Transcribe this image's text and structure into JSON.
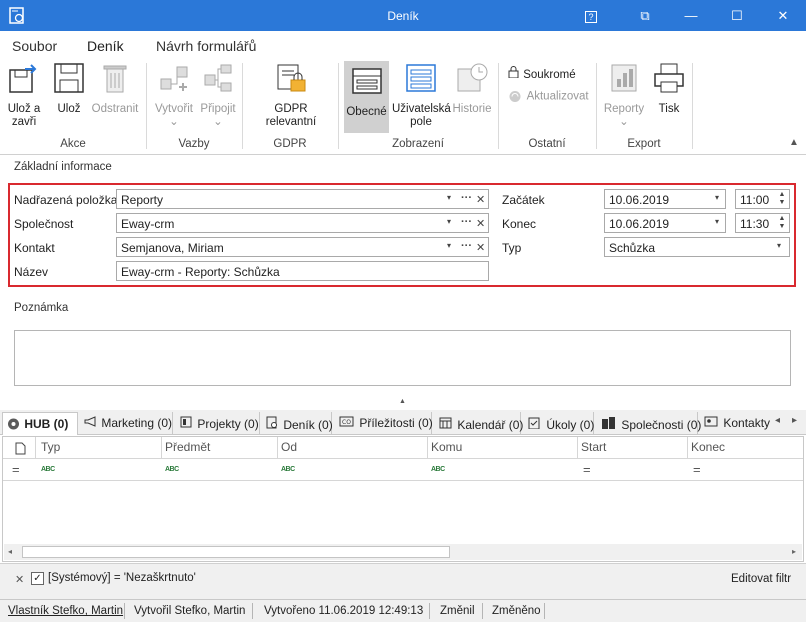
{
  "window": {
    "title": "Deník",
    "help_glyph": "?",
    "restore_glyph": "⧉",
    "min_glyph": "—",
    "max_glyph": "☐",
    "close_glyph": "✕"
  },
  "menu": {
    "tabs": [
      "Soubor",
      "Deník",
      "Návrh formulářů"
    ],
    "active": 1
  },
  "ribbon": {
    "save_close": "Ulož a zavři",
    "save": "Ulož",
    "delete": "Odstranit",
    "create": "Vytvořit",
    "attach": "Připojit",
    "gdpr_relevant": "GDPR relevantní",
    "general": "Obecné",
    "user_fields": "Uživatelská pole",
    "history": "Historie",
    "private": "Soukromé",
    "refresh": "Aktualizovat",
    "reports": "Reporty",
    "print": "Tisk",
    "groups": {
      "actions": "Akce",
      "links": "Vazby",
      "gdpr": "GDPR",
      "view": "Zobrazení",
      "other": "Ostatní",
      "export": "Export"
    },
    "dropdown_glyph": "⌄"
  },
  "form": {
    "section_title": "Základní informace",
    "parent_label": "Nadřazená položka",
    "parent_value": "Reporty",
    "company_label": "Společnost",
    "company_value": "Eway-crm",
    "contact_label": "Kontakt",
    "contact_value": "Semjanova, Miriam",
    "name_label": "Název",
    "name_value": "Eway-crm -  Reporty: Schůzka",
    "start_label": "Začátek",
    "start_date": "10.06.2019",
    "start_time": "11:00",
    "end_label": "Konec",
    "end_date": "10.06.2019",
    "end_time": "11:30",
    "type_label": "Typ",
    "type_value": "Schůzka",
    "dropdown_glyph": "▾",
    "more_glyph": "···",
    "clear_glyph": "✕",
    "spin_up": "▲",
    "spin_down": "▼"
  },
  "note": {
    "label": "Poznámka",
    "collapse_glyph": "▲"
  },
  "tabs": {
    "items": [
      "HUB (0)",
      "Marketing (0)",
      "Projekty (0)",
      "Deník (0)",
      "Příležitosti (0)",
      "Kalendář (0)",
      "Úkoly (0)",
      "Společnosti (0)",
      "Kontakty"
    ],
    "active": 0,
    "left_arrow": "◂",
    "right_arrow": "▸"
  },
  "grid": {
    "columns": [
      "Typ",
      "Předmět",
      "Od",
      "Komu",
      "Start",
      "Konec"
    ],
    "filter_equals": "=",
    "abc": "ABC"
  },
  "filter": {
    "text": "[Systémový] = 'Nezaškrtnuto'",
    "edit": "Editovat filtr",
    "clear_glyph": "✕",
    "check_glyph": "✓"
  },
  "status": {
    "owner": "Vlastník Stefko, Martin",
    "created_by": "Vytvořil Stefko, Martin",
    "created": "Vytvořeno 11.06.2019 12:49:13",
    "changed_by": "Změnil",
    "changed": "Změněno"
  },
  "colors": {
    "accent": "#2b78d8",
    "highlight": "#d9292f"
  }
}
